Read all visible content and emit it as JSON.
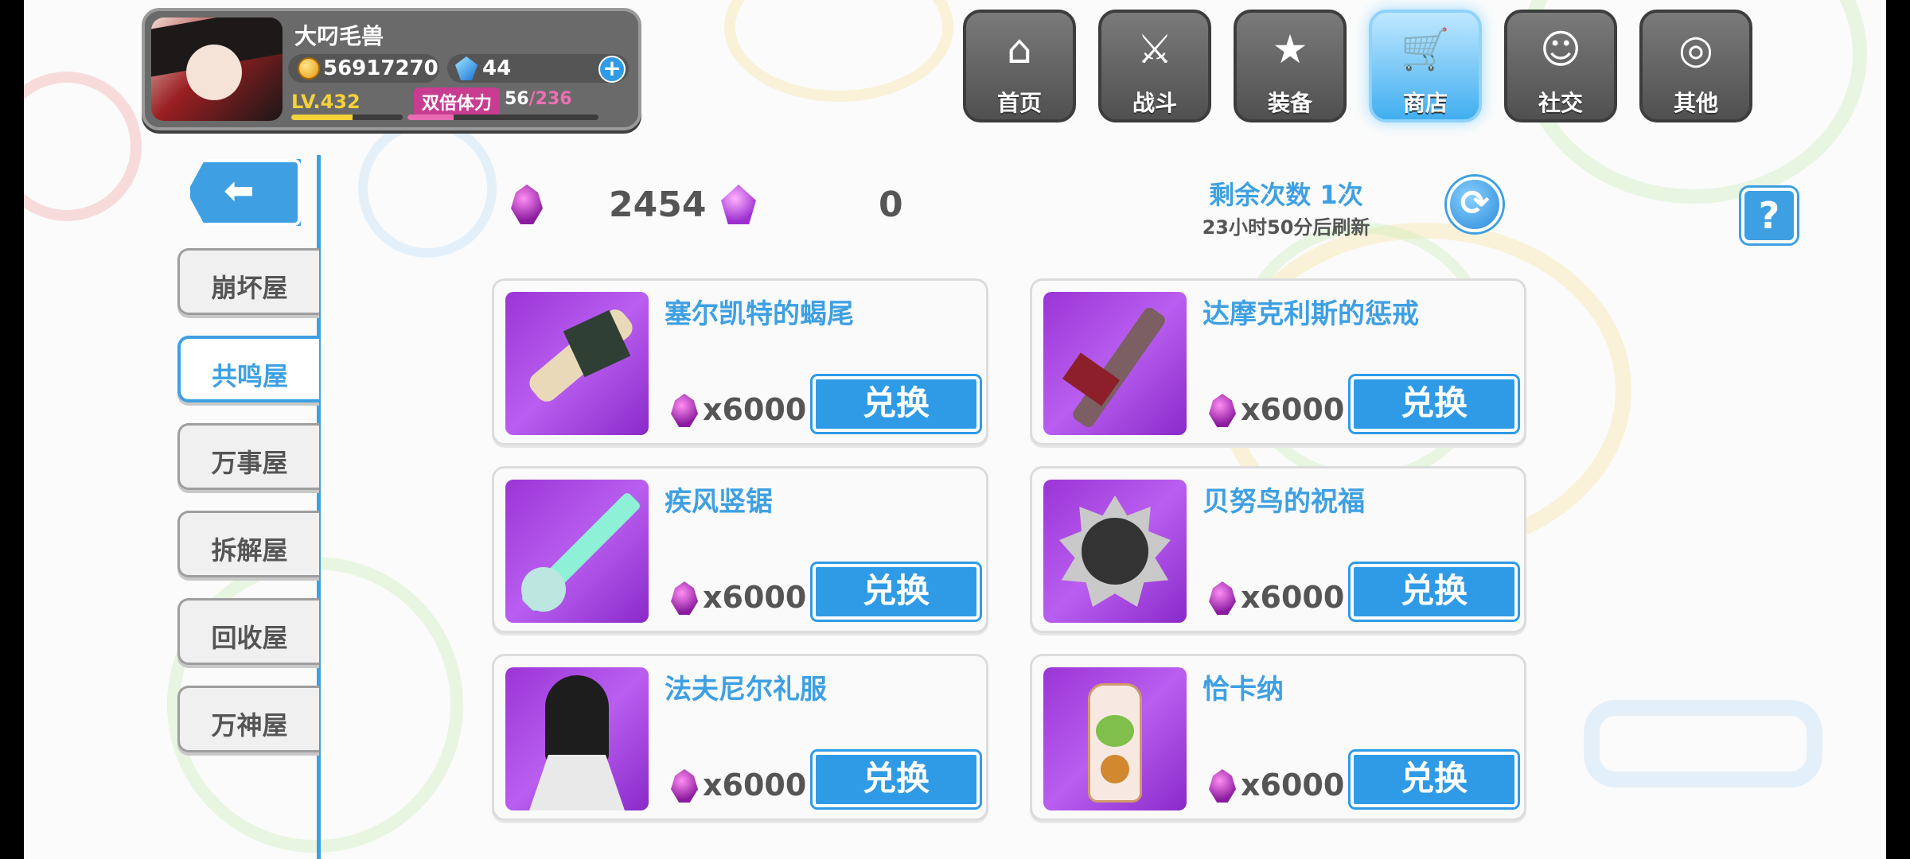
{
  "player": {
    "name": "大叼毛兽",
    "gold": "56917270",
    "crystals": "44",
    "level": "LV.432",
    "level_progress": 0.55,
    "stamina_label": "双倍体力",
    "stamina_current": "56",
    "stamina_max": "/236",
    "stamina_progress": 0.24
  },
  "nav": [
    {
      "label": "首页",
      "icon": "home-icon",
      "glyph": "⌂"
    },
    {
      "label": "战斗",
      "icon": "battle-icon",
      "glyph": "⚔"
    },
    {
      "label": "装备",
      "icon": "equipment-icon",
      "glyph": "★"
    },
    {
      "label": "商店",
      "icon": "shop-cart-icon",
      "glyph": "🛒"
    },
    {
      "label": "社交",
      "icon": "social-icon",
      "glyph": "☺"
    },
    {
      "label": "其他",
      "icon": "other-icon",
      "glyph": "◎"
    }
  ],
  "nav_active": "商店",
  "sidebar": {
    "back_icon": "back-arrow-icon",
    "items": [
      {
        "label": "崩坏屋"
      },
      {
        "label": "共鸣屋"
      },
      {
        "label": "万事屋"
      },
      {
        "label": "拆解屋"
      },
      {
        "label": "回收屋"
      },
      {
        "label": "万神屋"
      }
    ],
    "active": "共鸣屋"
  },
  "currency": {
    "primary_value": "2454",
    "secondary_value": "0",
    "primary_icon": "purple-gem-icon",
    "secondary_icon": "purple-crystal-icon"
  },
  "refresh": {
    "remaining": "剩余次数 1次",
    "time": "23小时50分后刷新",
    "icon": "refresh-icon"
  },
  "help_label": "?",
  "items": [
    {
      "name": "塞尔凯特的蝎尾",
      "cost": "x6000",
      "button": "兑换",
      "icon": "scorpion-tail-weapon-icon"
    },
    {
      "name": "达摩克利斯的惩戒",
      "cost": "x6000",
      "button": "兑换",
      "icon": "damocles-sword-icon"
    },
    {
      "name": "疾风竖锯",
      "cost": "x6000",
      "button": "兑换",
      "icon": "chainsaw-blade-icon"
    },
    {
      "name": "贝努鸟的祝福",
      "cost": "x6000",
      "button": "兑换",
      "icon": "bennu-bird-medal-icon"
    },
    {
      "name": "法夫尼尔礼服",
      "cost": "x6000",
      "button": "兑换",
      "icon": "fafnir-dress-icon"
    },
    {
      "name": "恰卡纳",
      "cost": "x6000",
      "button": "兑换",
      "icon": "chakana-bottle-icon"
    }
  ],
  "colors": {
    "accent": "#3ea0e2",
    "button": "#2f9be6",
    "gem": "#8a1b9e",
    "level": "#f5d23a",
    "stamina": "#c83d91"
  }
}
